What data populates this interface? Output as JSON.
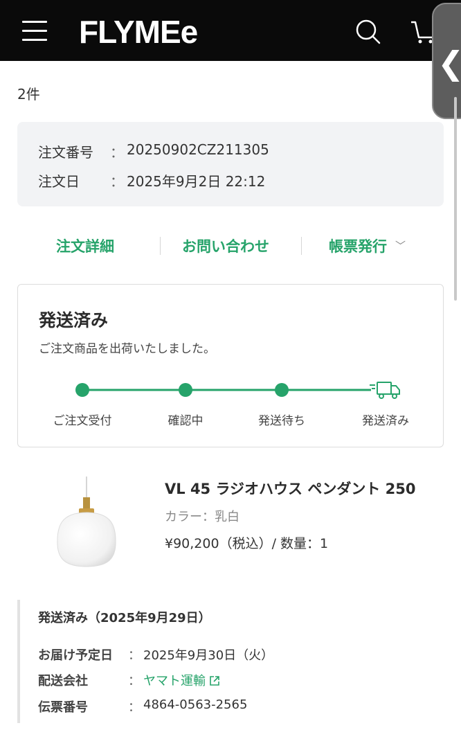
{
  "header": {
    "logo": "FLYMEe",
    "drawer_chevron": "❮",
    "icons": [
      "menu-icon",
      "search-icon",
      "cart-icon"
    ]
  },
  "order": {
    "count": "2件",
    "number_label": "注文番号",
    "number_value": "20250902CZ211305",
    "date_label": "注文日",
    "date_value": "2025年9月2日 22:12",
    "separator": "："
  },
  "actions": {
    "details": "注文詳細",
    "contact": "お問い合わせ",
    "invoice": "帳票発行",
    "invoice_caret": "﹀"
  },
  "shipping_status": {
    "title": "発送済み",
    "description": "ご注文商品を出荷いたしました。",
    "steps": [
      "ご注文受付",
      "確認中",
      "発送待ち",
      "発送済み"
    ],
    "current_step": 4,
    "accent_color": "#26a36a"
  },
  "product": {
    "name": "VL 45 ラジオハウス ペンダント 250",
    "color": "カラー：乳白",
    "price_line": "¥90,200（税込）/  数量：1"
  },
  "delivery": {
    "heading": "発送済み（2025年9月29日）",
    "eta_label": "お届け予定日",
    "eta_value": "2025年9月30日（火）",
    "carrier_label": "配送会社",
    "carrier_value": "ヤマト運輸",
    "tracking_label": "伝票番号",
    "tracking_value": "4864-0563-2565",
    "separator": "："
  }
}
